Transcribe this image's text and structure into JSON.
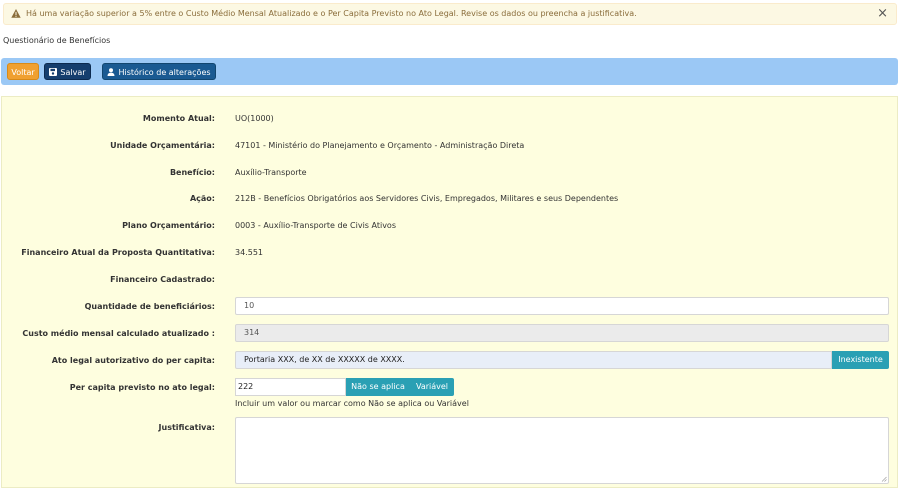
{
  "alert": {
    "message": "Há uma variação superior a 5% entre o Custo Médio Mensal Atualizado e o Per Capita Previsto no Ato Legal. Revise os dados ou preencha a justificativa.",
    "close": "×",
    "icon": "warning-icon"
  },
  "page": {
    "title": "Questionário de Benefícios"
  },
  "toolbar": {
    "back_label": "Voltar",
    "save_label": "Salvar",
    "history_label": "Histórico de alterações",
    "colors": {
      "bar": "#9bc8f5",
      "back": "#f0a030",
      "save": "#153e6e",
      "history": "#1a5a92"
    }
  },
  "form": {
    "momento_atual": {
      "label": "Momento Atual:",
      "value": "UO(1000)"
    },
    "unidade": {
      "label": "Unidade Orçamentária:",
      "value": "47101 - Ministério do Planejamento e Orçamento - Administração Direta"
    },
    "beneficio": {
      "label": "Benefício:",
      "value": "Auxílio-Transporte"
    },
    "acao": {
      "label": "Ação:",
      "value": "212B - Benefícios Obrigatórios aos Servidores Civis, Empregados, Militares e seus Dependentes"
    },
    "plano": {
      "label": "Plano Orçamentário:",
      "value": "0003 - Auxílio-Transporte de Civis Ativos"
    },
    "financeiro_atual": {
      "label": "Financeiro Atual da Proposta Quantitativa:",
      "value": "34.551"
    },
    "financeiro_cadastrado": {
      "label": "Financeiro Cadastrado:",
      "value": ""
    },
    "quantidade": {
      "label": "Quantidade de beneficiários:",
      "value": "10"
    },
    "custo_medio": {
      "label": "Custo médio mensal calculado atualizado :",
      "value": "314"
    },
    "ato_legal": {
      "label": "Ato legal autorizativo do per capita:",
      "value": "Portaria XXX, de XX de XXXXX de XXXX.",
      "button": "Inexistente"
    },
    "per_capita": {
      "label": "Per capita previsto no ato legal:",
      "value": "222",
      "na_button": "Não se aplica",
      "var_button": "Variável",
      "help": "Incluir um valor ou marcar como Não se aplica ou Variável"
    },
    "justificativa": {
      "label": "Justificativa:",
      "value": ""
    },
    "colors": {
      "panel": "#fefedf",
      "addon": "#2aa0b4"
    }
  }
}
